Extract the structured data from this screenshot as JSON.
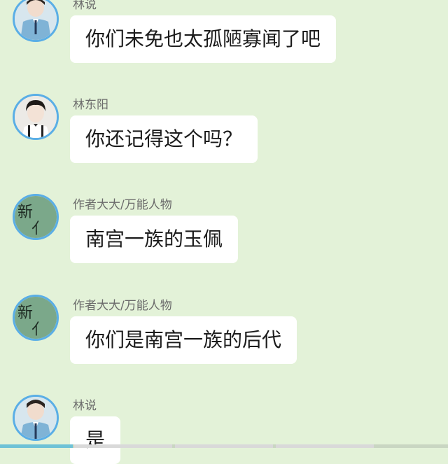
{
  "messages": [
    {
      "sender": "林说",
      "text": "你们未免也太孤陋寡闻了吧",
      "avatar": "boy-uniform-avatar"
    },
    {
      "sender": "林东阳",
      "text": "你还记得这个吗？",
      "avatar": "boy-suspenders-avatar"
    },
    {
      "sender": "作者大大/万能人物",
      "text": "南宫一族的玉佩",
      "avatar": "calligraphy-avatar",
      "avatar_text": "新"
    },
    {
      "sender": "作者大大/万能人物",
      "text": "你们是南宫一族的后代",
      "avatar": "calligraphy-avatar",
      "avatar_text": "新"
    },
    {
      "sender": "林说",
      "text": "是",
      "avatar": "boy-uniform-avatar"
    }
  ],
  "colors": {
    "background": "#e3f2d8",
    "bubble": "#ffffff",
    "avatar_border": "#5aaee6"
  }
}
